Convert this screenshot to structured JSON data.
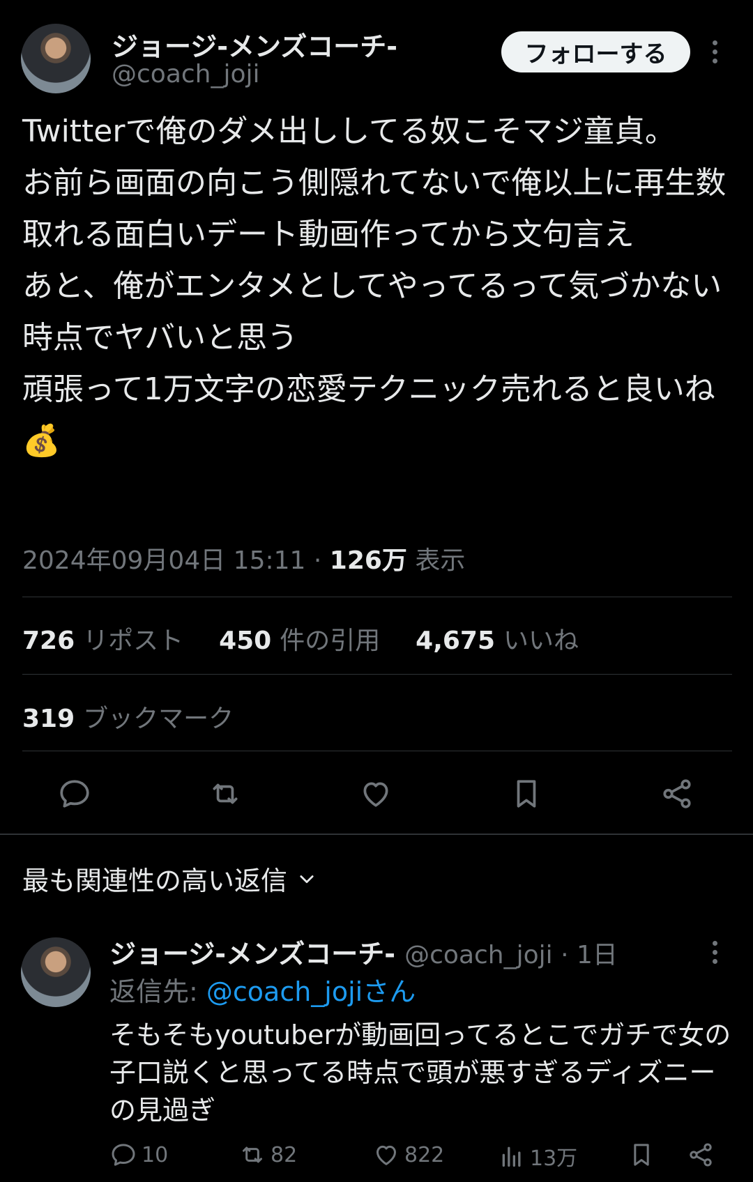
{
  "author": {
    "name": "ジョージ-メンズコーチ-",
    "handle": "@coach_joji"
  },
  "follow_label": "フォローする",
  "tweet": {
    "text": "Twitterで俺のダメ出ししてる奴こそマジ童貞。\nお前ら画面の向こう側隠れてないで俺以上に再生数取れる面白いデート動画作ってから文句言え\nあと、俺がエンタメとしてやってるって気づかない時点でヤバいと思う\n頑張って1万文字の恋愛テクニック売れると良いね💰",
    "datetime": "2024年09月04日 15:11 · ",
    "views_value": "126万",
    "views_label": " 表示"
  },
  "stats": {
    "reposts_value": "726",
    "reposts_label": "リポスト",
    "quotes_value": "450",
    "quotes_label": "件の引用",
    "likes_value": "4,675",
    "likes_label": "いいね",
    "bookmarks_value": "319",
    "bookmarks_label": "ブックマーク"
  },
  "replies_section": {
    "title": "最も関連性の高い返信"
  },
  "reply": {
    "name": "ジョージ-メンズコーチ-",
    "handle_time": "@coach_joji · 1日",
    "reply_to_label": "返信先: ",
    "reply_to_link": "@coach_jojiさん",
    "text": "そもそもyoutuberが動画回ってるとこでガチで女の子口説くと思ってる時点で頭が悪すぎるディズニーの見過ぎ",
    "replies": "10",
    "reposts": "82",
    "likes": "822",
    "views": "13万"
  },
  "icons": [
    "reply-icon",
    "retweet-icon",
    "like-icon",
    "bookmark-icon",
    "share-icon",
    "more-icon",
    "views-icon",
    "chevron-down-icon"
  ],
  "colors": {
    "background": "#000000",
    "text": "#e7e9ea",
    "muted": "#71767b",
    "link": "#1d9bf0",
    "divider": "#2f3336"
  }
}
